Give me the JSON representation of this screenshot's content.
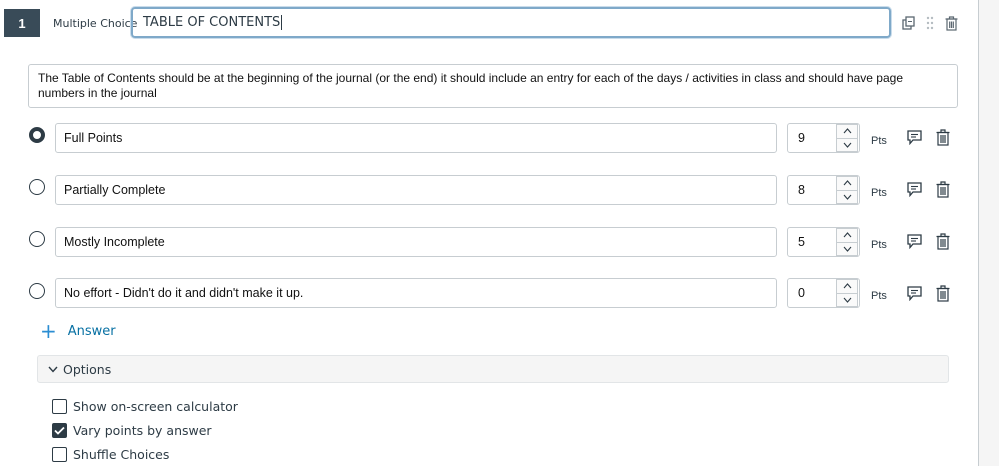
{
  "question": {
    "number": "1",
    "type_label": "Multiple Choice",
    "title": "TABLE OF CONTENTS",
    "stem": "The Table of Contents should be at the beginning of the journal (or the end) it should include an entry for each of the days / activities in class and should have page numbers in the journal"
  },
  "header_icons": [
    "copy-icon",
    "drag-handle-icon",
    "trash-icon"
  ],
  "answers": [
    {
      "text": "Full Points",
      "points": "9",
      "selected": true
    },
    {
      "text": "Partially Complete",
      "points": "8",
      "selected": false
    },
    {
      "text": "Mostly Incomplete",
      "points": "5",
      "selected": false
    },
    {
      "text": "No effort - Didn't do it and didn't make it up.",
      "points": "0",
      "selected": false
    }
  ],
  "pts_label": "Pts",
  "add_answer_label": "Answer",
  "options": {
    "label": "Options",
    "expanded": true,
    "items": [
      {
        "label": "Show on-screen calculator",
        "checked": false
      },
      {
        "label": "Vary points by answer",
        "checked": true
      },
      {
        "label": "Shuffle Choices",
        "checked": false
      }
    ]
  },
  "colors": {
    "accent": "#0770a3",
    "dark": "#2d3b45",
    "number_badge": "#394b58",
    "focus_border": "#7fa9c9"
  }
}
